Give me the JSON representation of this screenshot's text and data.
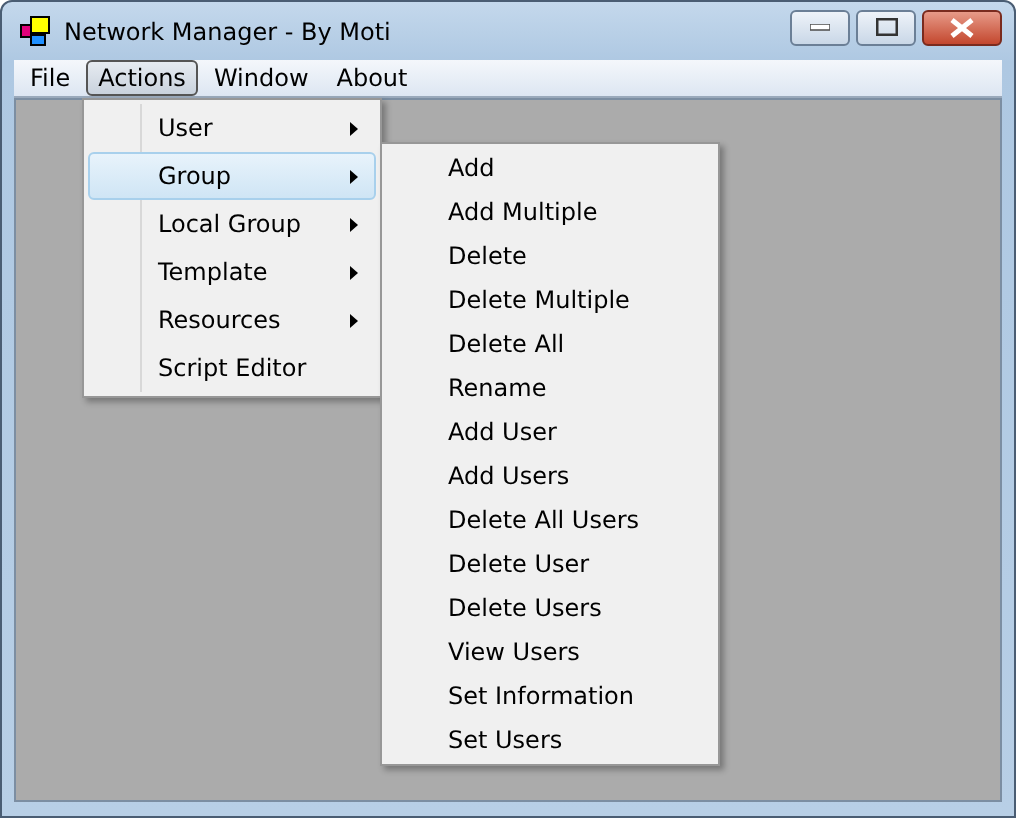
{
  "window": {
    "title": "Network Manager - By Moti"
  },
  "menu_bar": [
    {
      "label": "File",
      "selected": false
    },
    {
      "label": "Actions",
      "selected": true
    },
    {
      "label": "Window",
      "selected": false
    },
    {
      "label": "About",
      "selected": false
    }
  ],
  "actions_menu": [
    {
      "label": "User",
      "submenu": true,
      "selected": false
    },
    {
      "label": "Group",
      "submenu": true,
      "selected": true
    },
    {
      "label": "Local Group",
      "submenu": true,
      "selected": false
    },
    {
      "label": "Template",
      "submenu": true,
      "selected": false
    },
    {
      "label": "Resources",
      "submenu": true,
      "selected": false
    },
    {
      "label": "Script Editor",
      "submenu": false,
      "selected": false
    }
  ],
  "group_submenu": [
    "Add",
    "Add Multiple",
    "Delete",
    "Delete Multiple",
    "Delete All",
    "Rename",
    "Add User",
    "Add Users",
    "Delete All Users",
    "Delete User",
    "Delete Users",
    "View Users",
    "Set Information",
    "Set Users"
  ]
}
